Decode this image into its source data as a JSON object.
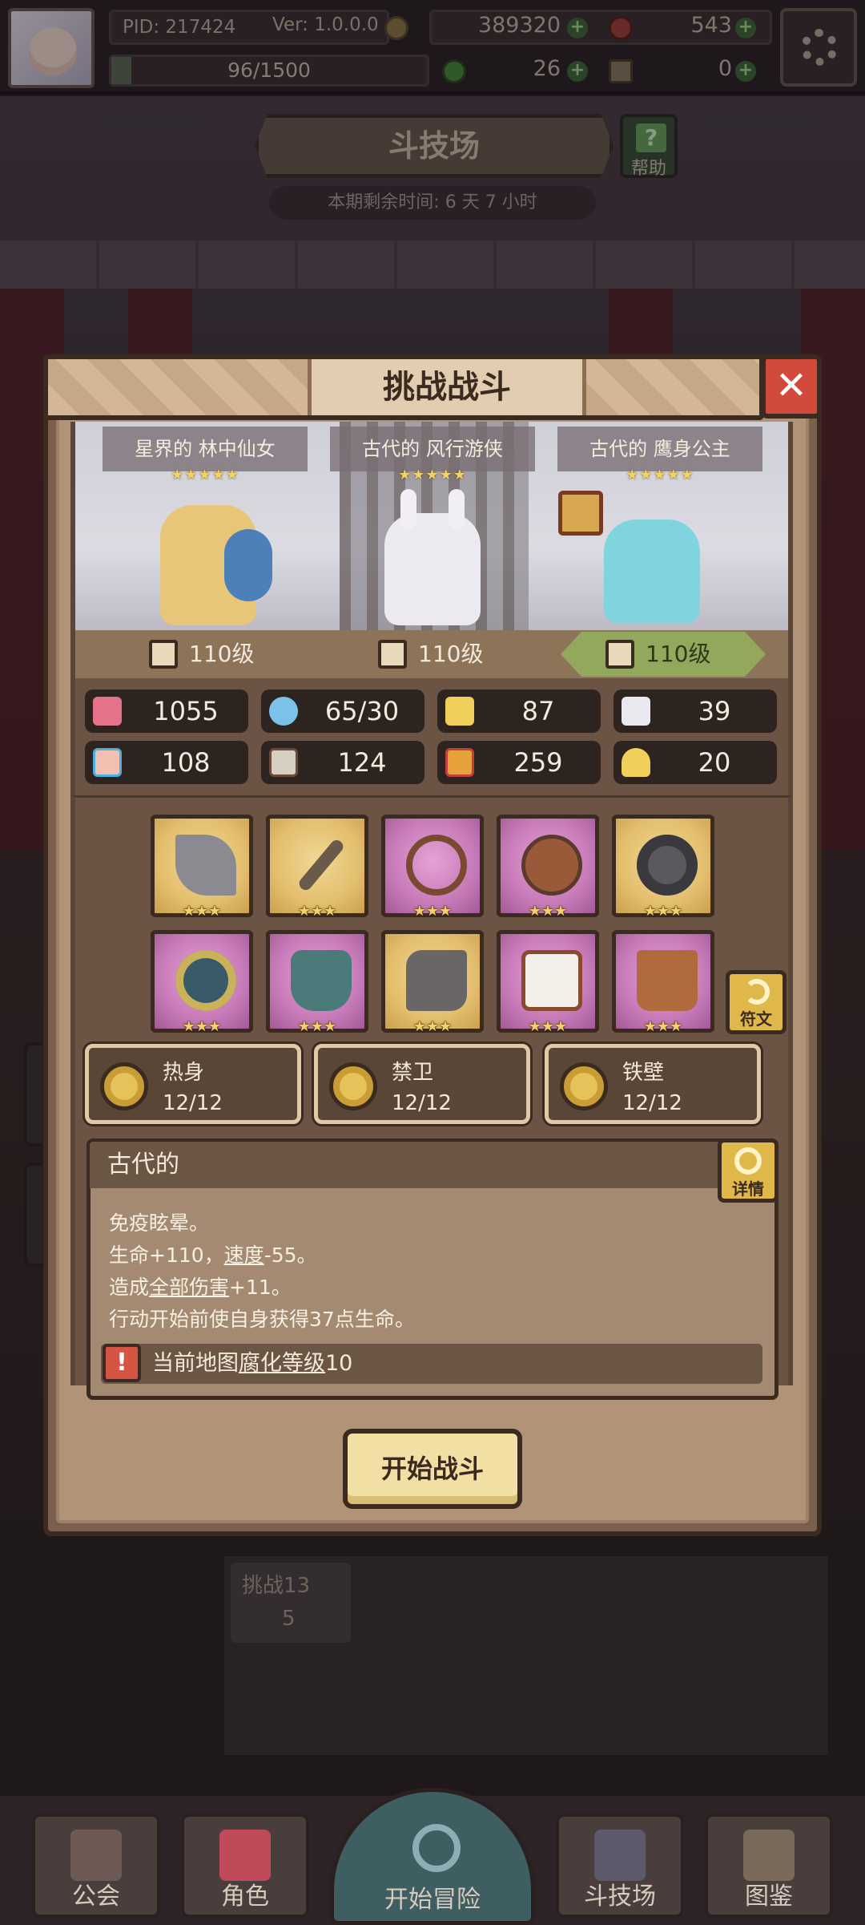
{
  "top_bar": {
    "pid": "PID: 217424",
    "version": "Ver: 1.0.0.0",
    "gold": "389320",
    "gems": "543",
    "exp": "96/1500",
    "exp_progress": 0.064,
    "clover": "26",
    "keys": "0"
  },
  "arena": {
    "title": "斗技场",
    "help_label": "帮助",
    "season_remaining": "本期剩余时间: 6 天 7 小时"
  },
  "modal": {
    "title": "挑战战斗",
    "heroes": [
      {
        "name": "星界的 林中仙女",
        "stars": "★★★★★",
        "level": "110级"
      },
      {
        "name": "古代的 风行游侠",
        "stars": "★★★★★",
        "level": "110级"
      },
      {
        "name": "古代的 鹰身公主",
        "stars": "★★★★★",
        "level": "110级"
      }
    ],
    "stats": [
      {
        "icon": "heart-icon",
        "value": "1055"
      },
      {
        "icon": "water-drop-icon",
        "value": "65/30"
      },
      {
        "icon": "shield-icon",
        "value": "87"
      },
      {
        "icon": "wing-icon",
        "value": "39"
      },
      {
        "icon": "fist-icon",
        "value": "108"
      },
      {
        "icon": "book-icon",
        "value": "124"
      },
      {
        "icon": "scroll-icon",
        "value": "259"
      },
      {
        "icon": "horseshoe-icon",
        "value": "20"
      }
    ],
    "equipment": [
      {
        "name": "crossbow-icon",
        "rarity": "gold",
        "stars": "★★★"
      },
      {
        "name": "spear-icon",
        "rarity": "gold",
        "stars": "★★★"
      },
      {
        "name": "amulet-icon",
        "rarity": "purple",
        "stars": "★★★"
      },
      {
        "name": "round-shield-icon",
        "rarity": "purple",
        "stars": "★★★"
      },
      {
        "name": "ring-icon",
        "rarity": "gold",
        "stars": "★★★"
      },
      {
        "name": "orb-armor-icon",
        "rarity": "purple",
        "stars": "★★★"
      },
      {
        "name": "chestplate-icon",
        "rarity": "purple",
        "stars": "★★★"
      },
      {
        "name": "gauntlet-icon",
        "rarity": "gold",
        "stars": "★★★"
      },
      {
        "name": "belt-icon",
        "rarity": "purple",
        "stars": "★★★"
      },
      {
        "name": "boots-icon",
        "rarity": "purple",
        "stars": "★★★"
      }
    ],
    "rune_label": "符文",
    "skills": [
      {
        "name": "热身",
        "count": "12/12"
      },
      {
        "name": "禁卫",
        "count": "12/12"
      },
      {
        "name": "铁壁",
        "count": "12/12"
      }
    ],
    "trait_title": "古代的",
    "detail_label": "详情",
    "trait_lines": {
      "l1": "免疫眩晕。",
      "l2_a": "生命+110，",
      "l2_b": "速度",
      "l2_c": "-55。",
      "l3_a": "造成",
      "l3_b": "全部伤害",
      "l3_c": "+11。",
      "l4": "行动开始前使自身获得37点生命。"
    },
    "warning_a": "当前地图",
    "warning_b": "腐化等级",
    "warning_c": "10",
    "start_button": "开始战斗"
  },
  "background": {
    "challenge_label": "挑战13",
    "challenge_count": "5"
  },
  "bottom_nav": [
    {
      "label": "公会"
    },
    {
      "label": "角色"
    },
    {
      "label": "开始冒险"
    },
    {
      "label": "斗技场"
    },
    {
      "label": "图鉴"
    }
  ]
}
